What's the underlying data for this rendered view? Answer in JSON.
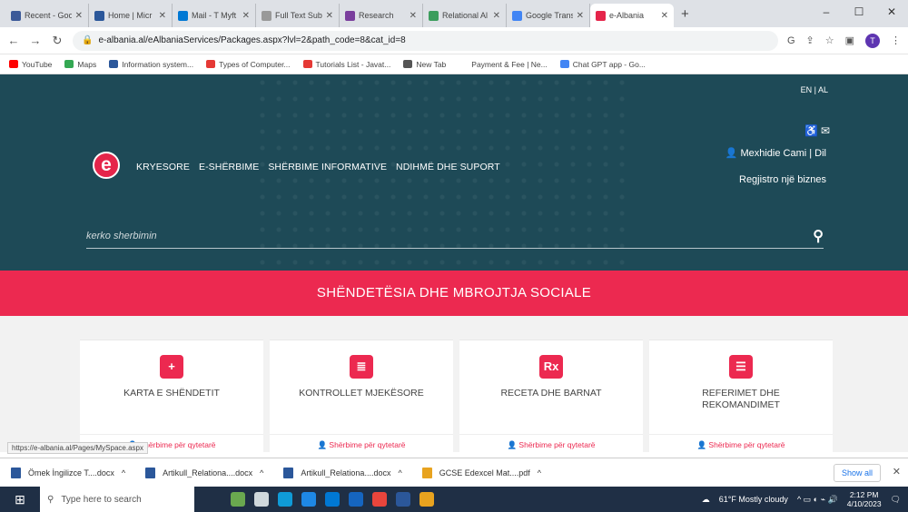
{
  "browser": {
    "tabs": [
      {
        "title": "Recent - Goo",
        "color": "#3b5998"
      },
      {
        "title": "Home | Micr",
        "color": "#2b579a"
      },
      {
        "title": "Mail - T Myft",
        "color": "#0078d4"
      },
      {
        "title": "Full Text Sub",
        "color": "#999999"
      },
      {
        "title": "Research",
        "color": "#7a3e9d"
      },
      {
        "title": "Relational Al",
        "color": "#3c9d5d"
      },
      {
        "title": "Google Trans",
        "color": "#4285f4"
      },
      {
        "title": "e-Albania",
        "color": "#e5254a",
        "active": true
      }
    ],
    "new_tab": "+",
    "url": "e-albania.al/eAlbaniaServices/Packages.aspx?lvl=2&path_code=8&cat_id=8",
    "bookmarks": [
      {
        "label": "YouTube",
        "color": "#ff0000"
      },
      {
        "label": "Maps",
        "color": "#34a853"
      },
      {
        "label": "Information system...",
        "color": "#2b579a"
      },
      {
        "label": "Types of Computer...",
        "color": "#e53935"
      },
      {
        "label": "Tutorials List - Javat...",
        "color": "#e53935"
      },
      {
        "label": "New Tab",
        "color": "#555555"
      },
      {
        "label": "Payment & Fee | Ne...",
        "color": "#ffffff"
      },
      {
        "label": "Chat GPT app - Go...",
        "color": "#4285f4"
      }
    ]
  },
  "site": {
    "lang": "EN | AL",
    "user": "Mexhidie Cami  |  Dil",
    "register": "Regjistro një biznes",
    "logo_letter": "e",
    "nav": [
      "KRYESORE",
      "E-SHËRBIME",
      "SHËRBIME INFORMATIVE",
      "NDIHMË DHE SUPORT"
    ],
    "search_placeholder": "kerko sherbimin",
    "category_title": "SHËNDETËSIA DHE MBROJTJA SOCIALE",
    "cards": [
      {
        "title": "KARTA E SHËNDETIT",
        "icon": "add-user-icon",
        "glyph": "+",
        "footer": "Shërbime për qytetarë"
      },
      {
        "title": "KONTROLLET MJEKËSORE",
        "icon": "checklist-icon",
        "glyph": "≣",
        "footer": "Shërbime për qytetarë"
      },
      {
        "title": "RECETA DHE BARNAT",
        "icon": "prescription-icon",
        "glyph": "Rx",
        "footer": "Shërbime për qytetarë"
      },
      {
        "title": "REFERIMET DHE REKOMANDIMET",
        "icon": "id-card-icon",
        "glyph": "☰",
        "footer": "Shërbime për qytetarë"
      }
    ],
    "status_url": "https://e-albania.al/Pages/MySpace.aspx",
    "accent": "#ec2950",
    "header_bg": "#1e4a57"
  },
  "downloads": {
    "items": [
      {
        "name": "Ömek İngilizce T....docx"
      },
      {
        "name": "Artikull_Relationa....docx"
      },
      {
        "name": "Artikull_Relationa....docx"
      },
      {
        "name": "GCSE Edexcel Mat....pdf"
      }
    ],
    "show_all": "Show all"
  },
  "taskbar": {
    "search": "Type here to search",
    "weather": "61°F  Mostly cloudy",
    "time": "2:12 PM",
    "date": "4/10/2023"
  }
}
